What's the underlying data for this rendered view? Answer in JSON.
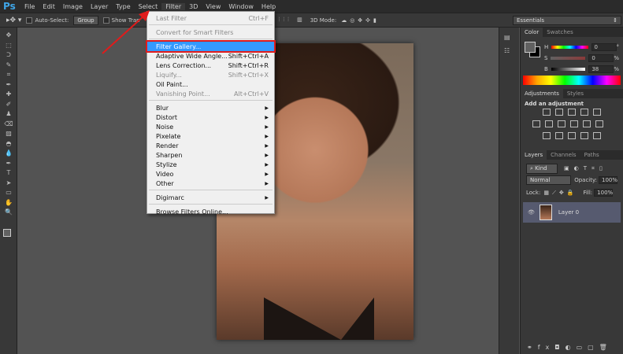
{
  "app": {
    "logo": "Ps"
  },
  "menubar": [
    "File",
    "Edit",
    "Image",
    "Layer",
    "Type",
    "Select",
    "Filter",
    "3D",
    "View",
    "Window",
    "Help"
  ],
  "options": {
    "auto_select": "Auto-Select:",
    "group": "Group",
    "show_transform": "Show Tran",
    "mode_3d": "3D Mode:",
    "workspace": "Essentials"
  },
  "filter_menu": [
    {
      "label": "Last Filter",
      "shortcut": "Ctrl+F",
      "disabled": true
    },
    {
      "sep": true
    },
    {
      "label": "Convert for Smart Filters",
      "disabled": true
    },
    {
      "sep": true
    },
    {
      "label": "Filter Gallery...",
      "highlighted": true
    },
    {
      "label": "Adaptive Wide Angle...",
      "shortcut": "Shift+Ctrl+A"
    },
    {
      "label": "Lens Correction...",
      "shortcut": "Shift+Ctrl+R"
    },
    {
      "label": "Liquify...",
      "shortcut": "Shift+Ctrl+X",
      "disabled": true
    },
    {
      "label": "Oil Paint..."
    },
    {
      "label": "Vanishing Point...",
      "shortcut": "Alt+Ctrl+V",
      "disabled": true
    },
    {
      "sep": true
    },
    {
      "label": "Blur",
      "sub": true
    },
    {
      "label": "Distort",
      "sub": true
    },
    {
      "label": "Noise",
      "sub": true
    },
    {
      "label": "Pixelate",
      "sub": true
    },
    {
      "label": "Render",
      "sub": true
    },
    {
      "label": "Sharpen",
      "sub": true
    },
    {
      "label": "Stylize",
      "sub": true
    },
    {
      "label": "Video",
      "sub": true
    },
    {
      "label": "Other",
      "sub": true
    },
    {
      "sep": true
    },
    {
      "label": "Digimarc",
      "sub": true
    },
    {
      "sep": true
    },
    {
      "label": "Browse Filters Online..."
    }
  ],
  "color_panel": {
    "tabs": [
      "Color",
      "Swatches"
    ],
    "h_label": "H",
    "h": "0",
    "s_label": "S",
    "s": "0",
    "b_label": "B",
    "b": "38",
    "pct": "%",
    "deg": "°"
  },
  "adjust_panel": {
    "tabs": [
      "Adjustments",
      "Styles"
    ],
    "title": "Add an adjustment"
  },
  "layers_panel": {
    "tabs": [
      "Layers",
      "Channels",
      "Paths"
    ],
    "kind": "Kind",
    "blend": "Normal",
    "opacity_label": "Opacity:",
    "opacity": "100%",
    "lock_label": "Lock:",
    "fill_label": "Fill:",
    "fill": "100%",
    "layer_name": "Layer 0"
  },
  "colors": {
    "highlight": "#3399ff",
    "annotation": "#e01b1b",
    "ps_blue": "#3fa6e8"
  }
}
